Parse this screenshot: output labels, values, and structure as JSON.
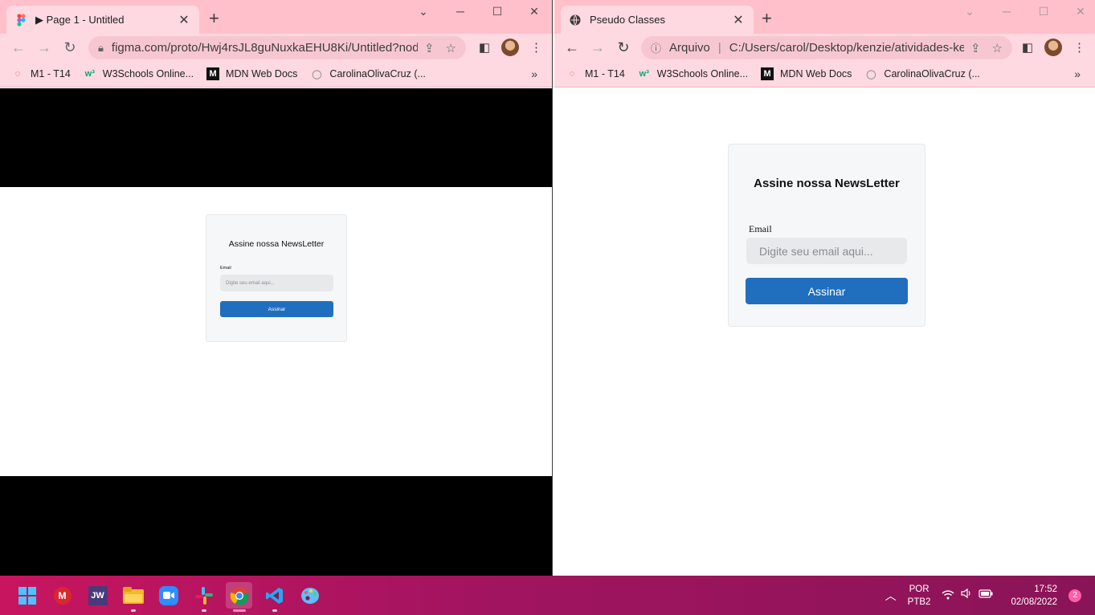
{
  "left_window": {
    "tab_title": "▶ Page 1 - Untitled",
    "url": "figma.com/proto/Hwj4rsJL8guNuxkaEHU8Ki/Untitled?nod...",
    "bookmarks": [
      "M1 - T14",
      "W3Schools Online...",
      "MDN Web Docs",
      "CarolinaOlivaCruz (..."
    ],
    "card": {
      "title": "Assine nossa NewsLetter",
      "label": "Email",
      "placeholder": "Digite seu email aqui...",
      "button": "Assinar"
    }
  },
  "right_window": {
    "tab_title": "Pseudo Classes",
    "url_prefix": "Arquivo",
    "url": "C:/Users/carol/Desktop/kenzie/atividades-ke...",
    "bookmarks": [
      "M1 - T14",
      "W3Schools Online...",
      "MDN Web Docs",
      "CarolinaOlivaCruz (..."
    ],
    "card": {
      "title": "Assine nossa NewsLetter",
      "label": "Email",
      "placeholder": "Digite seu email aqui...",
      "button": "Assinar"
    }
  },
  "taskbar": {
    "apps": [
      "windows-start",
      "mega",
      "jw",
      "file-explorer",
      "zoom",
      "slack",
      "chrome",
      "vscode",
      "paint"
    ],
    "jw_label": "JW",
    "language": "POR",
    "layout": "PTB2",
    "time": "17:52",
    "date": "02/08/2022",
    "notification_count": "2"
  },
  "colors": {
    "chrome_frame": "#ffc0cb",
    "chrome_toolbar": "#ffd9e1",
    "button_blue": "#1f6fbe",
    "card_bg": "#f6f7f9",
    "taskbar": "#a11460"
  }
}
